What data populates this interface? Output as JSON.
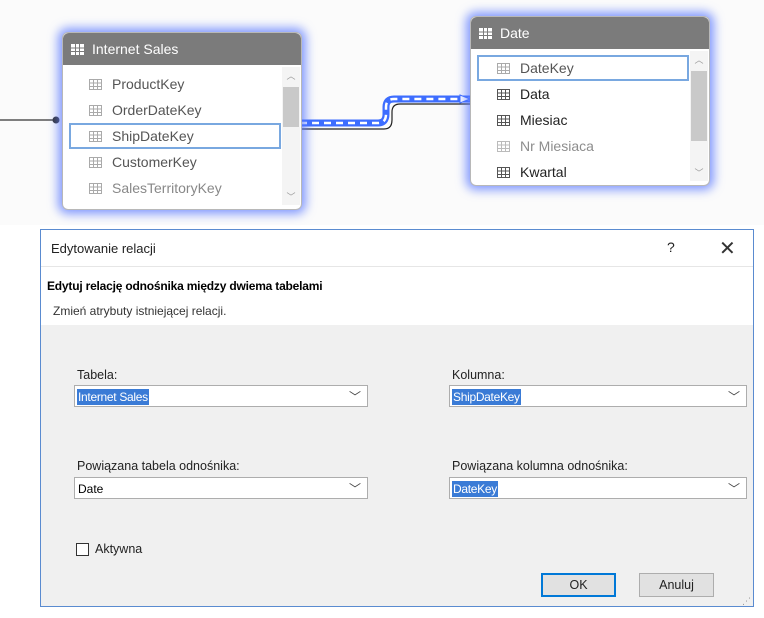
{
  "diagram": {
    "internet_sales": {
      "title": "Internet Sales",
      "fields": [
        "ProductKey",
        "OrderDateKey",
        "ShipDateKey",
        "CustomerKey",
        "SalesTerritoryKey"
      ]
    },
    "date": {
      "title": "Date",
      "fields": [
        "DateKey",
        "Data",
        "Miesiac",
        "Nr Miesiaca",
        "Kwartal"
      ]
    }
  },
  "dialog": {
    "title": "Edytowanie relacji",
    "help_label": "?",
    "close_label": "✕",
    "heading": "Edytuj relację odnośnika między dwiema tabelami",
    "subheading": "Zmień atrybuty istniejącej relacji.",
    "table_label": "Tabela:",
    "table_value": "Internet Sales",
    "column_label": "Kolumna:",
    "column_value": "ShipDateKey",
    "related_table_label": "Powiązana tabela odnośnika:",
    "related_table_value": "Date",
    "related_column_label": "Powiązana kolumna odnośnika:",
    "related_column_value": "DateKey",
    "active_label": "Aktywna",
    "active_checked": false,
    "ok_label": "OK",
    "cancel_label": "Anuluj"
  },
  "colors": {
    "header_gray": "#7b7b7b",
    "glow": "#5a78ff",
    "highlight_border": "#79a8e0",
    "selection": "#3a7bd6",
    "dialog_border": "#5a8bd0"
  }
}
